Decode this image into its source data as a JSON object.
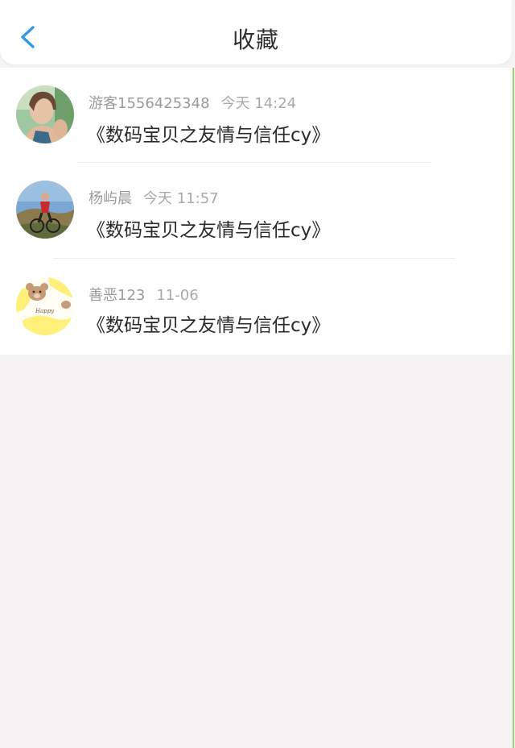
{
  "header": {
    "title": "收藏",
    "back_icon": "chevron-left-icon",
    "accent": "#2f9be6"
  },
  "favorites": [
    {
      "user": "游客1556425348",
      "time": "今天 14:24",
      "title": "《数码宝贝之友情与信任cy》",
      "avatar": "woman-portrait-avatar"
    },
    {
      "user": "杨屿晨",
      "time": "今天 11:57",
      "title": "《数码宝贝之友情与信任cy》",
      "avatar": "cyclist-avatar"
    },
    {
      "user": "善恶123",
      "time": "11-06",
      "title": "《数码宝贝之友情与信任cy》",
      "avatar": "bear-cartoon-avatar"
    }
  ]
}
